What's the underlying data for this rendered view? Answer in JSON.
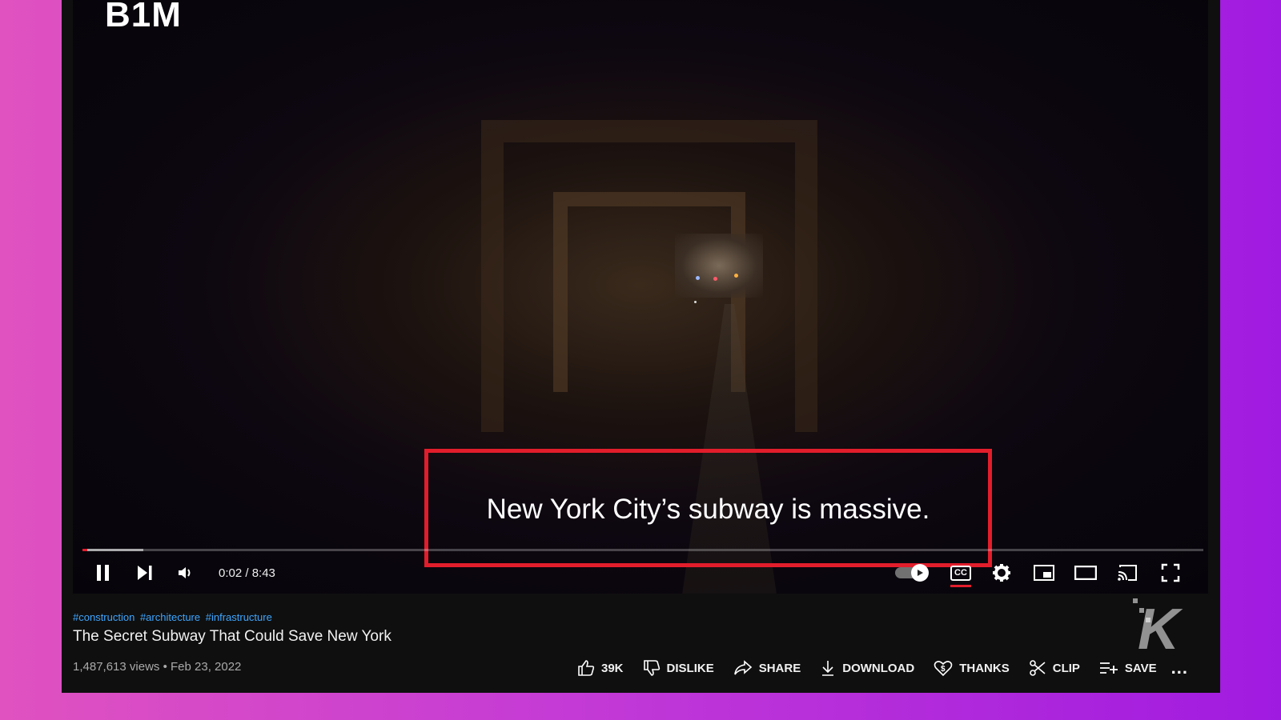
{
  "player": {
    "channel_logo": "B1M",
    "caption": "New York City’s subway is massive.",
    "time": "0:02 / 8:43",
    "progress_fraction": 0.004,
    "buffer_fraction": 0.05,
    "autoplay_on": true,
    "captions_on": true,
    "cc_label": "CC",
    "accent_color": "#e21d2b",
    "highlight_color": "#e21d2b"
  },
  "video": {
    "hashtags": [
      "#construction",
      "#architecture",
      "#infrastructure"
    ],
    "title": "The Secret Subway That Could Save New York",
    "views": "1,487,613 views",
    "date": "Feb 23, 2022"
  },
  "actions": {
    "like": "39K",
    "dislike": "DISLIKE",
    "share": "SHARE",
    "download": "DOWNLOAD",
    "thanks": "THANKS",
    "clip": "CLIP",
    "save": "SAVE",
    "more": "..."
  },
  "watermark": "K",
  "colors": {
    "link": "#3ea6ff",
    "background_left": "#e052c0",
    "background_right": "#a01be0"
  }
}
